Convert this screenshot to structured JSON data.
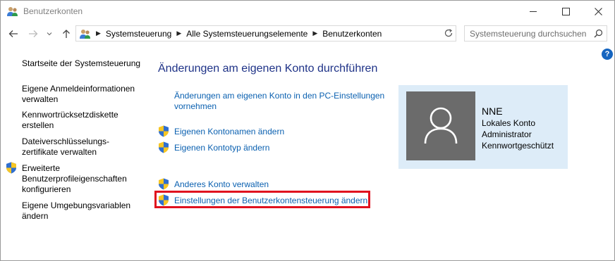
{
  "window": {
    "title": "Benutzerkonten"
  },
  "address": {
    "crumbs": [
      "Systemsteuerung",
      "Alle Systemsteuerungselemente",
      "Benutzerkonten"
    ],
    "search_placeholder": "Systemsteuerung durchsuchen"
  },
  "help": {
    "label": "?"
  },
  "sidebar": {
    "items": [
      {
        "lines": [
          "Startseite der Systemsteuerung"
        ],
        "shield": false
      },
      {
        "lines": [
          "Eigene Anmeldeinformationen",
          "verwalten"
        ],
        "shield": false
      },
      {
        "lines": [
          "Kennwortrücksetzdiskette",
          "erstellen"
        ],
        "shield": false
      },
      {
        "lines": [
          "Dateiverschlüsselungs-",
          "zertifikate verwalten"
        ],
        "shield": false
      },
      {
        "lines": [
          "Erweiterte",
          "Benutzerprofileigenschaften",
          "konfigurieren"
        ],
        "shield": true
      },
      {
        "lines": [
          "Eigene Umgebungsvariablen",
          "ändern"
        ],
        "shield": false
      }
    ]
  },
  "main": {
    "heading": "Änderungen am eigenen Konto durchführen",
    "pc_settings_link": [
      "Änderungen am eigenen Konto in den PC-Einstellungen",
      "vornehmen"
    ],
    "links": {
      "change_name": "Eigenen Kontonamen ändern",
      "change_type": "Eigenen Kontotyp ändern",
      "manage_other": "Anderes Konto verwalten",
      "uac_settings": "Einstellungen der Benutzerkontensteuerung ändern"
    }
  },
  "account": {
    "name": "NNE",
    "type": "Lokales Konto",
    "role": "Administrator",
    "protection": "Kennwortgeschützt"
  },
  "colors": {
    "link": "#0a60b0",
    "heading": "#1e3287",
    "highlight": "#e0111e",
    "card_bg": "#ddecf8",
    "avatar_bg": "#6b6b6b"
  }
}
